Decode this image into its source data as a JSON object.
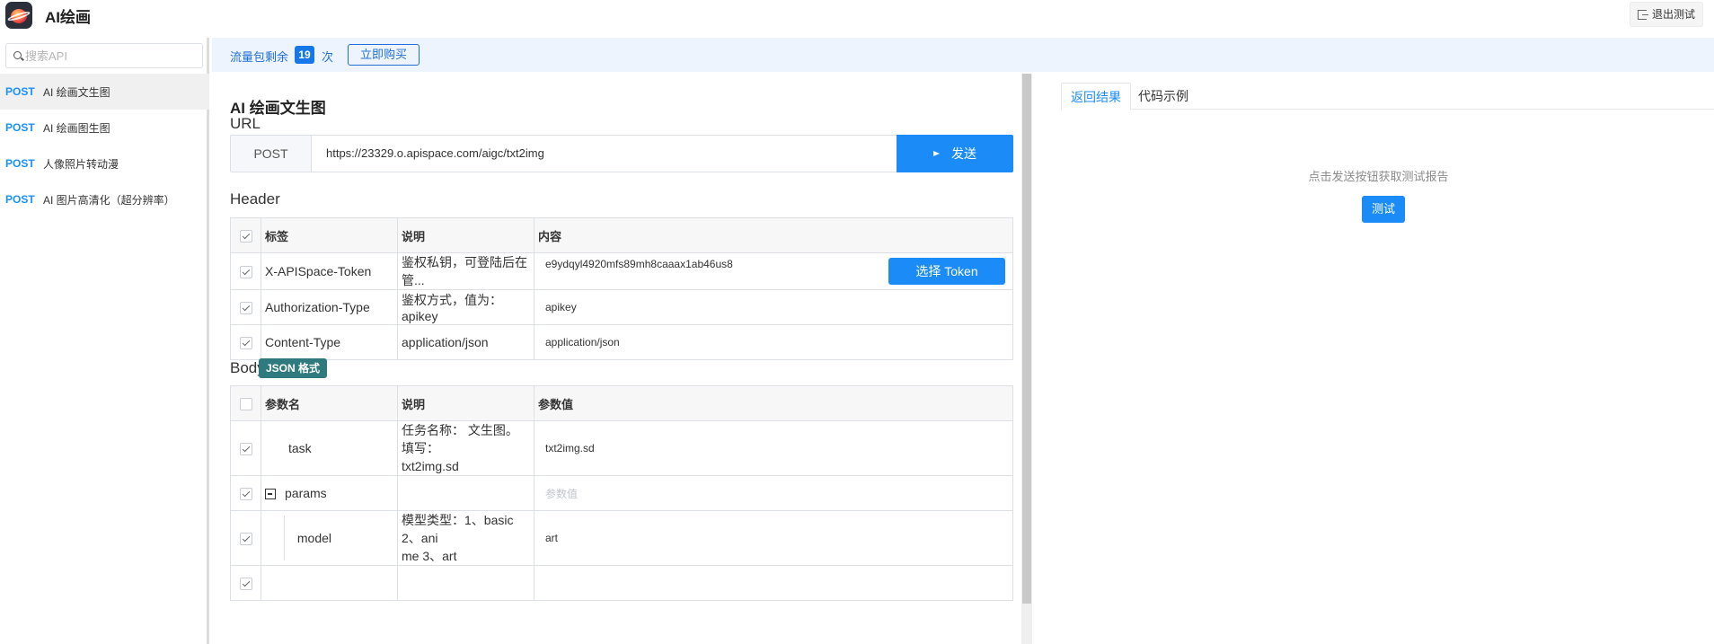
{
  "app": {
    "title": "AI绘画"
  },
  "header": {
    "logout_label": "退出测试"
  },
  "sidebar": {
    "search_placeholder": "搜索API",
    "items": [
      {
        "method": "POST",
        "label": "AI 绘画文生图"
      },
      {
        "method": "POST",
        "label": "AI 绘画图生图"
      },
      {
        "method": "POST",
        "label": "人像照片转动漫"
      },
      {
        "method": "POST",
        "label": "AI 图片高清化（超分辨率）"
      }
    ]
  },
  "quota": {
    "prefix": "流量包剩余",
    "count": "19",
    "unit": "次",
    "buy_label": "立即购买"
  },
  "main": {
    "title": "AI 绘画文生图",
    "url_section": "URL",
    "method": "POST",
    "url": "https://23329.o.apispace.com/aigc/txt2img",
    "send_label": "发送",
    "header_section": "Header",
    "header_columns": [
      "标签",
      "说明",
      "内容"
    ],
    "header_rows": [
      {
        "label": "X-APISpace-Token",
        "desc": "鉴权私钥，可登陆后在管...",
        "value": "e9ydqyl4920mfs89mh8caaax1ab46us8",
        "button": "选择 Token"
      },
      {
        "label": "Authorization-Type",
        "desc": "鉴权方式，值为：apikey",
        "value": "apikey"
      },
      {
        "label": "Content-Type",
        "desc": "application/json",
        "value": "application/json"
      }
    ],
    "body_section": "Body",
    "body_badge": "JSON 格式",
    "body_columns": [
      "参数名",
      "说明",
      "参数值"
    ],
    "body_rows": [
      {
        "name": "task",
        "desc_line1": "任务名称： 文生图。填写：",
        "desc_line2": "txt2img.sd",
        "value": "txt2img.sd"
      },
      {
        "name": "params",
        "desc": "",
        "value_placeholder": "参数值"
      },
      {
        "name": "model",
        "desc_line1": "模型类型：1、basic 2、ani",
        "desc_line2": "me 3、art",
        "value": "art"
      }
    ]
  },
  "right": {
    "tabs": [
      "返回结果",
      "代码示例"
    ],
    "hint": "点击发送按钮获取测试报告",
    "test_label": "测试"
  }
}
